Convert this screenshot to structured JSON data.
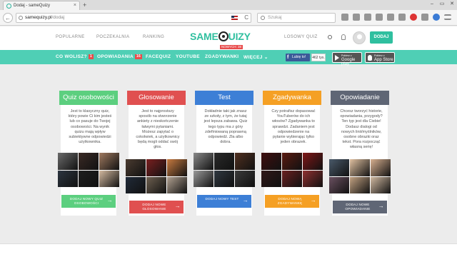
{
  "browser": {
    "tab_title": "Dodaj - sameQuizy",
    "tab_close": "×",
    "new_tab": "+",
    "url_host": "samequizy.pl",
    "url_path": "/dodaj",
    "search_placeholder": "Szukaj",
    "win_min": "–",
    "win_max": "▭",
    "win_close": "✕",
    "back": "←",
    "reload": "C"
  },
  "header": {
    "nav": [
      "POPULARNE",
      "POCZEKALNIA",
      "RANKING"
    ],
    "logo_left": "SAME",
    "logo_right": "UIZY",
    "logo_badge": "NOWYCH: 38",
    "random_quiz": "LOSOWY QUIZ",
    "add_button": "DODAJ"
  },
  "greennav": {
    "items": [
      {
        "label": "CO WOLISZ?",
        "badge": "1"
      },
      {
        "label": "OPOWIADANIA",
        "badge": "16"
      },
      {
        "label": "FACEQUIZ",
        "badge": ""
      },
      {
        "label": "YOUTUBE",
        "badge": ""
      },
      {
        "label": "ZGADYWANKI",
        "badge": ""
      },
      {
        "label": "WIĘCEJ ⌄",
        "badge": ""
      }
    ],
    "fb_like": "Lubię to!",
    "fb_count": "462 tys.",
    "google_play_small": "Pobierz z",
    "google_play": "Google play",
    "app_store_small": "Pobierz z",
    "app_store": "App Store"
  },
  "cards": [
    {
      "title": "Quiz osobowości",
      "color": "#5ccf7f",
      "desc": "Jest to klasyczny quiz, który powie Ci kim jesteś lub co pasuje do Twojej osobowości. Na wynik quizu mają wpływ subiektywne odpowiedzi użytkownika.",
      "button": "DODAJ NOWY QUIZ OSOBOWOŚCI",
      "thumbs": [
        "#6b6b6b",
        "#3a2a25",
        "#a07a60",
        "#2c3540",
        "#1f1f1f",
        "#d3b9a0"
      ]
    },
    {
      "title": "Głosowanie",
      "color": "#e05050",
      "desc": "Jest to najprostszy sposób na stworzenie ankiety z nieskończenie łatwymi pytaniami. Możesz zapytać o cokolwiek, a użytkownicy będą mogli oddać swój głos.",
      "button": "DODAJ NOWE GŁOSOWANIE",
      "thumbs": [
        "#4a3b30",
        "#7a2020",
        "#c77a40",
        "#202a38",
        "#6e6050",
        "#b0a090"
      ]
    },
    {
      "title": "Test",
      "color": "#3d7fd6",
      "desc": "Dokładnie taki jak znasz ze szkoły, z tym, że tutaj jest lepsza zabawa. Quiz tego typu ma z góry zdefiniowaną poprawną odpowiedź. Zła albo dobra.",
      "button": "DODAJ NOWY TEST",
      "thumbs": [
        "#8a8a8a",
        "#2a2a2a",
        "#503020",
        "#9a9a9a",
        "#303840",
        "#3a3a3a"
      ]
    },
    {
      "title": "Zgadywanka",
      "color": "#f5a024",
      "desc": "Czy potrafisz dopasować YouTuberów do ich włosów? Zgadywanka to sprawdzi. Zadaniem jest odpowiedzenie na pytanie wybierając tylko jeden obrazek.",
      "button": "DODAJ NOWĄ ZGADYWANKĘ",
      "thumbs": [
        "#401010",
        "#5a1a10",
        "#801818",
        "#301818",
        "#6a2020",
        "#903030"
      ]
    },
    {
      "title": "Opowiadanie",
      "color": "#5f6675",
      "desc": "Chcesz tworzyć historie, opowiadania, przygody? Ten typ jest dla Ciebie! Dodasz dialogi od nowych linii/myślników, osobne obrazki oraz tekst. Pora rozpocząć własną serię!",
      "button": "DODAJ NOWE OPOWIADANIE",
      "thumbs": [
        "#4a5a6a",
        "#e0c0a0",
        "#d8b090",
        "#6a5060",
        "#c0a080",
        "#d0b8a0"
      ]
    }
  ]
}
